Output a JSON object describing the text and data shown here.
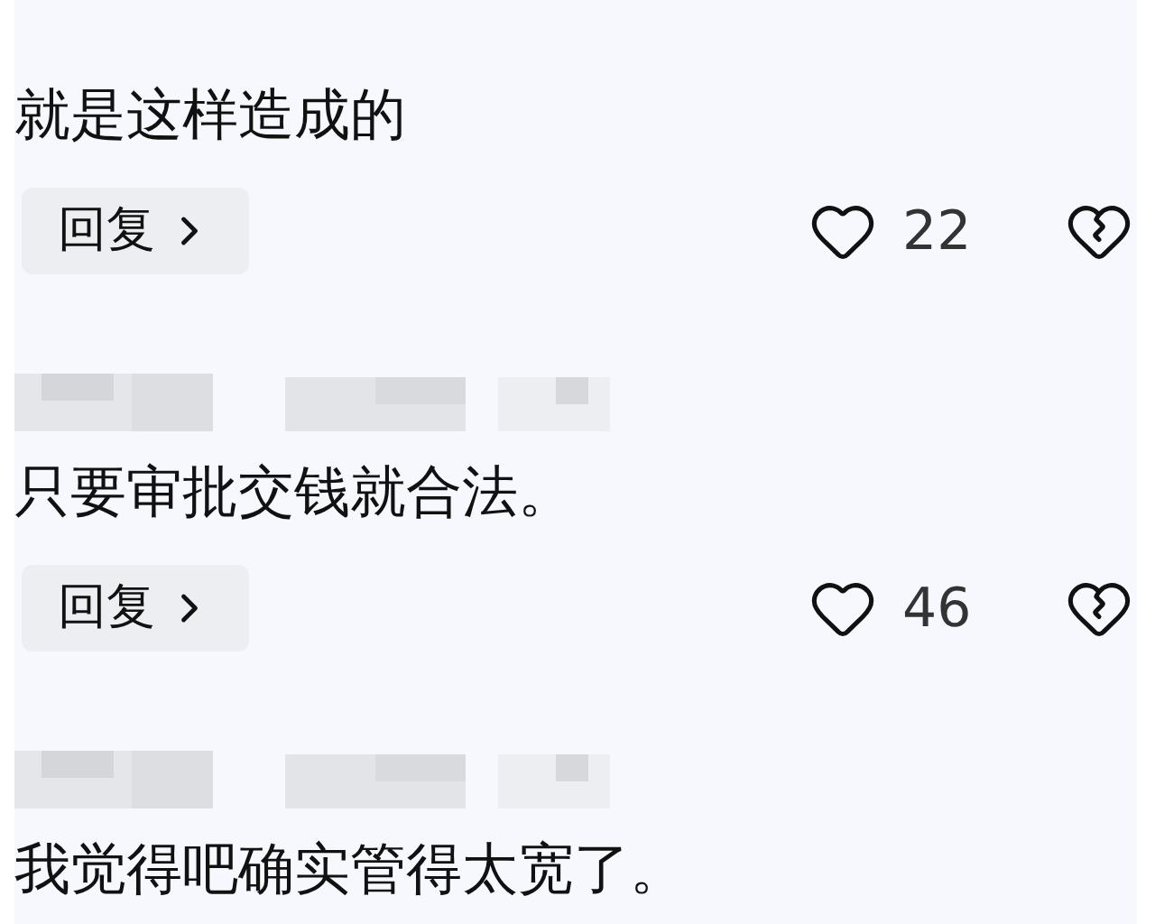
{
  "comments": [
    {
      "text": "就是这样造成的",
      "reply": "回复",
      "likes": "22"
    },
    {
      "username_blurred": true,
      "text": "只要审批交钱就合法。",
      "reply": "回复",
      "likes": "46"
    },
    {
      "username_blurred": true,
      "text": "我觉得吧确实管得太宽了。"
    }
  ]
}
